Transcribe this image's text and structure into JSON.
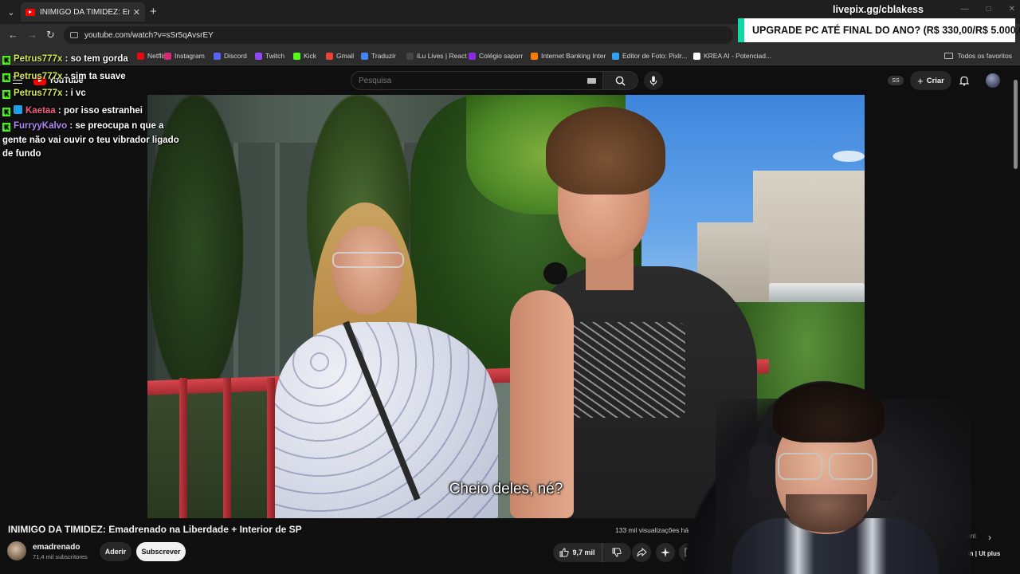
{
  "browser": {
    "tab_title": "INIMIGO DA TIMIDEZ: Emadrenado na Liberdade",
    "url": "youtube.com/watch?v=sSr5qAvsrEY",
    "bookmarks": [
      {
        "label": "Netflix",
        "color": "#e50914"
      },
      {
        "label": "Instagram",
        "color": "#d62976"
      },
      {
        "label": "Discord",
        "color": "#5865f2"
      },
      {
        "label": "Twitch",
        "color": "#9146ff"
      },
      {
        "label": "Kick",
        "color": "#53fc18"
      },
      {
        "label": "Gmail",
        "color": "#ea4335"
      },
      {
        "label": "Traduzir",
        "color": "#4285f4"
      },
      {
        "label": "iLu Lives | React",
        "color": "#444444"
      },
      {
        "label": "Colégio saporr",
        "color": "#8a2be2"
      },
      {
        "label": "Internet Banking Inter",
        "color": "#ff7a00"
      },
      {
        "label": "Editor de Foto: Pixlr...",
        "color": "#2ea3f2"
      },
      {
        "label": "KREA AI - Potenciad...",
        "color": "#ffffff"
      }
    ],
    "all_bookmarks": "Todos os favoritos"
  },
  "overlay": {
    "livepix": "livepix.gg/cblakess",
    "upgrade": "UPGRADE PC ATÉ FINAL DO ANO? (R$ 330,00/R$ 5.000,00)"
  },
  "youtube": {
    "logo_text": "YouTube",
    "search_placeholder": "Pesquisa",
    "ss_badge": "SS",
    "create_label": "Criar"
  },
  "video": {
    "subtitle": "Cheio deles, né?",
    "title": "INIMIGO DA TIMIDEZ: Emadrenado na Liberdade + Interior de SP",
    "views": "133 mil visualizações  há",
    "channel_name": "emadrenado",
    "channel_subs": "71,4 mil subscritores",
    "join_label": "Aderir",
    "subscribe_label": "Subscrever",
    "likes": "9,7 mil",
    "right_partial_top": "ecent",
    "right_partial": "llation | Ut plus"
  },
  "chat": [
    {
      "user": "Petrus777x",
      "msg": ": so tem gorda",
      "color": "u1"
    },
    {
      "user": "Petrus777x",
      "msg": ": sim ta suave",
      "color": "u1"
    },
    {
      "user": "Petrus777x",
      "msg": ": i vc",
      "color": "u1"
    },
    {
      "user": "Kaetaa",
      "msg": ": por isso estranhei",
      "color": "u2"
    },
    {
      "user": "FurryyKalvo",
      "msg": ": se preocupa n que a gente não vai ouvir o teu vibrador ligado de fundo",
      "color": "u3"
    }
  ]
}
